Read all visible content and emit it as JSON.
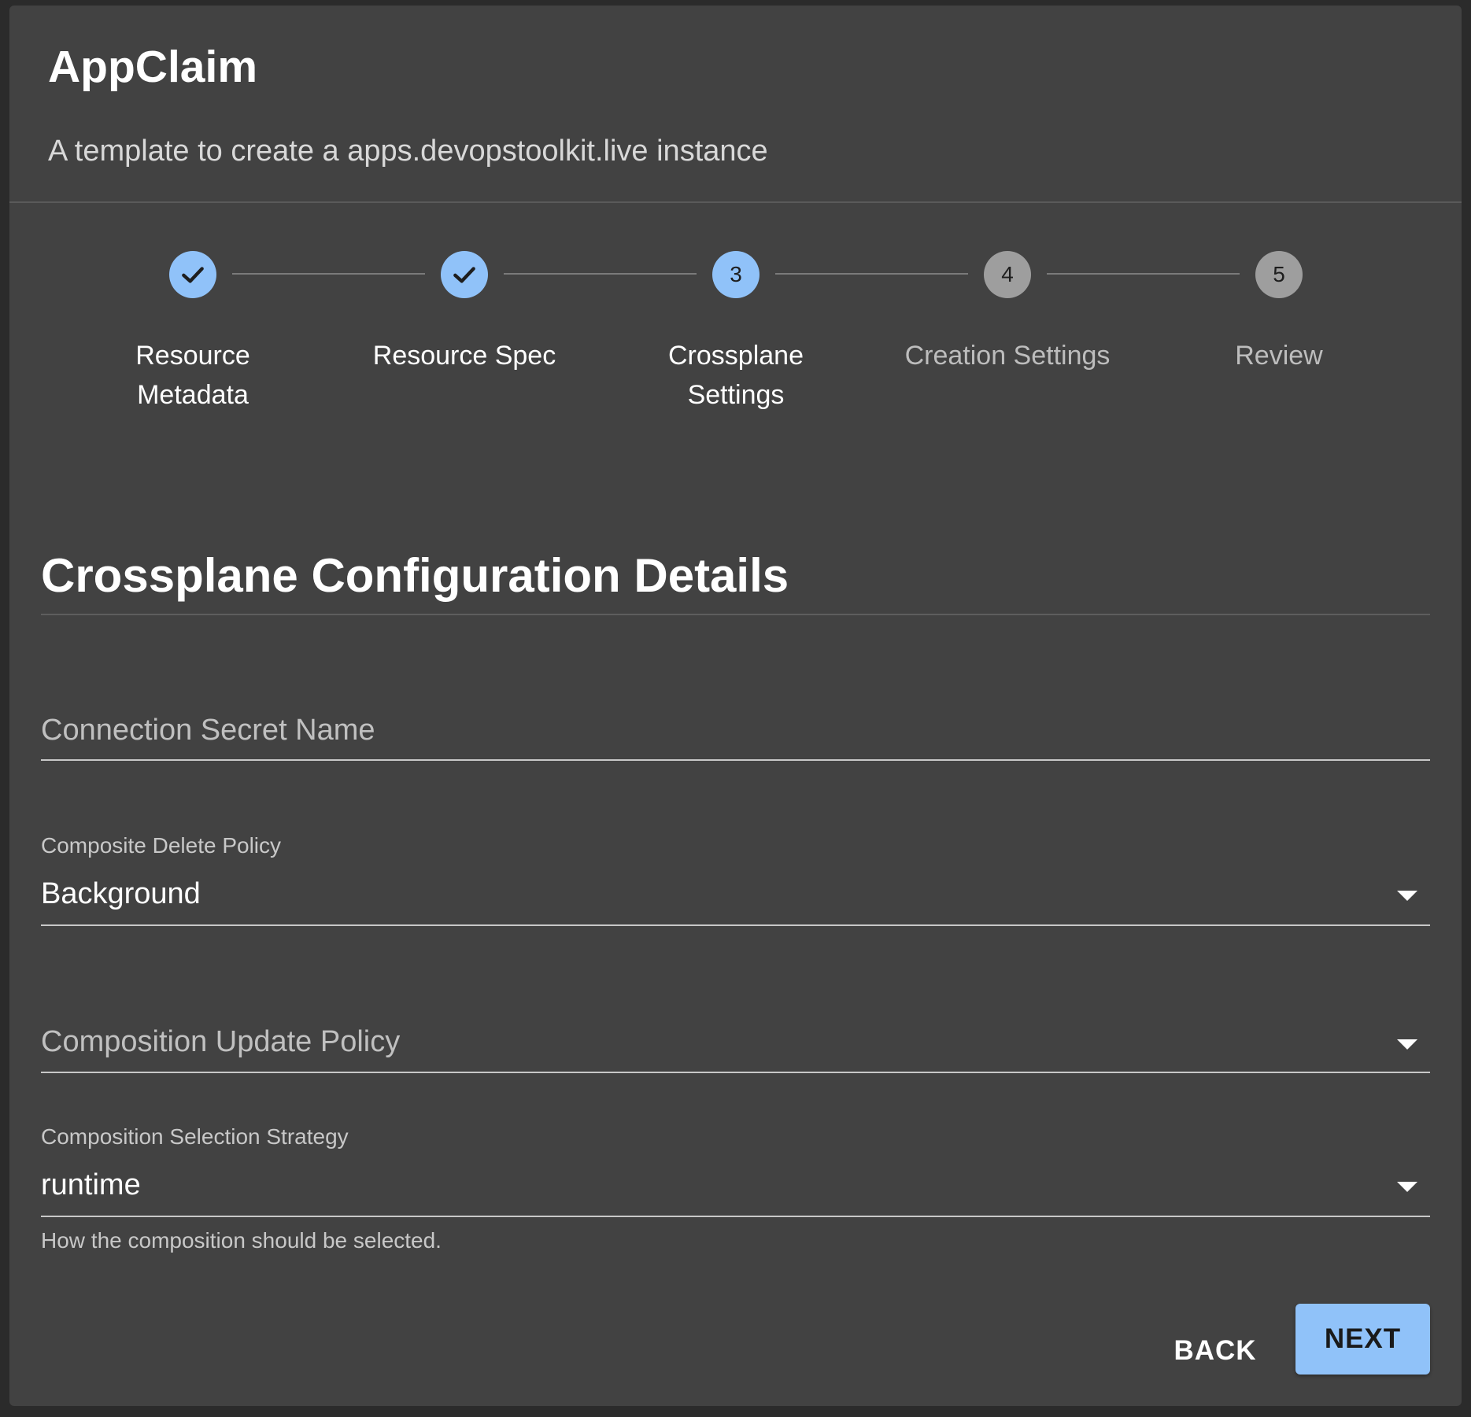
{
  "header": {
    "title": "AppClaim",
    "subtitle": "A template to create a apps.devopstoolkit.live instance"
  },
  "stepper": {
    "steps": [
      {
        "number": "1",
        "label_line1": "Resource",
        "label_line2": "Metadata",
        "status": "completed",
        "icon": "check-icon"
      },
      {
        "number": "2",
        "label_line1": "Resource Spec",
        "label_line2": "",
        "status": "completed",
        "icon": "check-icon"
      },
      {
        "number": "3",
        "label_line1": "Crossplane",
        "label_line2": "Settings",
        "status": "active"
      },
      {
        "number": "4",
        "label_line1": "Creation Settings",
        "label_line2": "",
        "status": "pending"
      },
      {
        "number": "5",
        "label_line1": "Review",
        "label_line2": "",
        "status": "pending"
      }
    ]
  },
  "section": {
    "title": "Crossplane Configuration Details"
  },
  "form": {
    "connection_secret": {
      "placeholder": "Connection Secret Name",
      "value": ""
    },
    "composite_delete_policy": {
      "label": "Composite Delete Policy",
      "value": "Background"
    },
    "composition_update_policy": {
      "placeholder": "Composition Update Policy",
      "value": ""
    },
    "composition_selection_strategy": {
      "label": "Composition Selection Strategy",
      "value": "runtime",
      "helper": "How the composition should be selected."
    }
  },
  "actions": {
    "back_label": "BACK",
    "next_label": "NEXT"
  },
  "colors": {
    "background": "#424242",
    "accent": "#90c2f9",
    "pending_step": "#9e9e9e"
  }
}
